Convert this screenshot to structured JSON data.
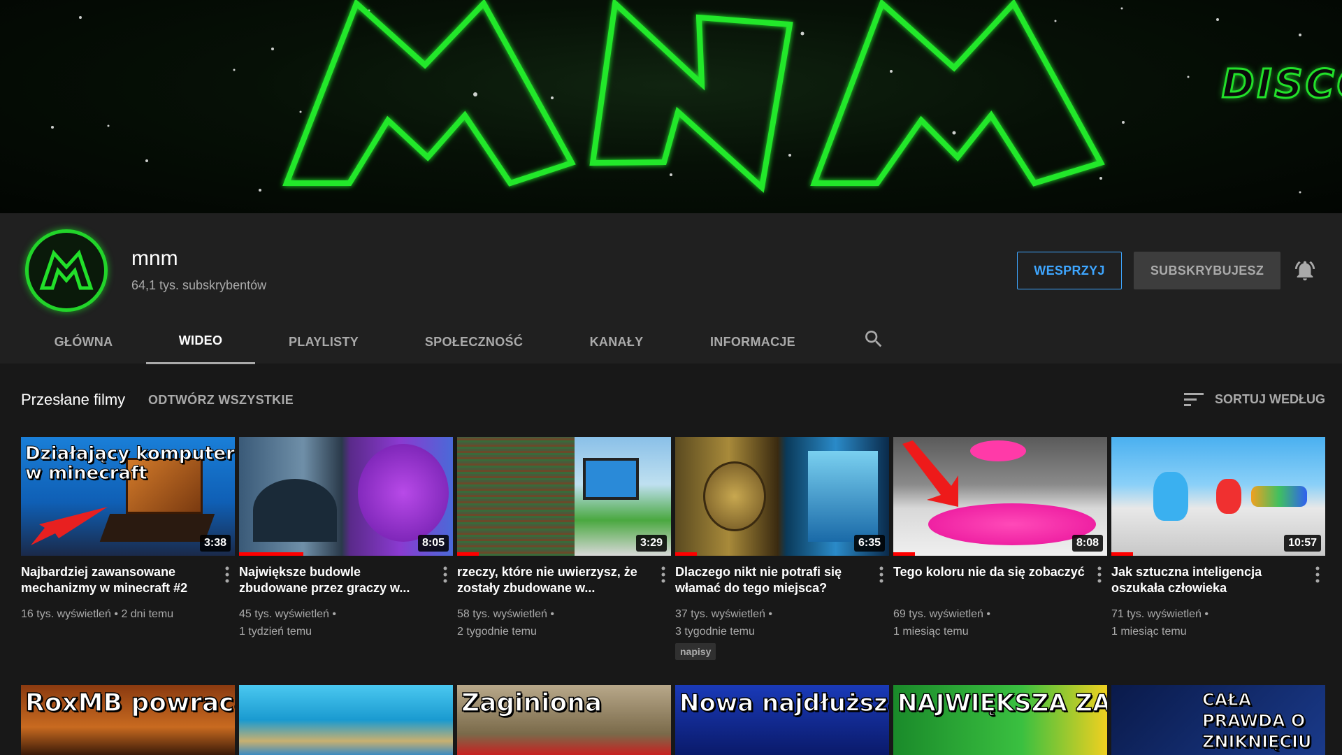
{
  "banner": {
    "logo_text": "MNM",
    "side_text": "DISCO"
  },
  "channel": {
    "name": "mnm",
    "subscribers": "64,1 tys. subskrybentów",
    "support_label": "WESPRZYJ",
    "subscribed_label": "SUBSKRYBUJESZ"
  },
  "tabs": [
    {
      "label": "GŁÓWNA"
    },
    {
      "label": "WIDEO",
      "active": true
    },
    {
      "label": "PLAYLISTY"
    },
    {
      "label": "SPOŁECZNOŚĆ"
    },
    {
      "label": "KANAŁY"
    },
    {
      "label": "INFORMACJE"
    }
  ],
  "section": {
    "title": "Przesłane filmy",
    "play_all": "ODTWÓRZ WSZYSTKIE",
    "sort_label": "SORTUJ WEDŁUG"
  },
  "videos": [
    {
      "title": "Najbardziej zawansowane mechanizmy w minecraft #2",
      "duration": "3:38",
      "views": "16 tys. wyświetleń",
      "age": "2 dni temu",
      "thumb_text": "Działający komputer w minecraft",
      "watched": 0
    },
    {
      "title": "Największe budowle zbudowane przez graczy w...",
      "duration": "8:05",
      "views": "45 tys. wyświetleń",
      "age": "1 tydzień temu",
      "watched": 0.3
    },
    {
      "title": "rzeczy, które nie uwierzysz, że zostały zbudowane w...",
      "duration": "3:29",
      "views": "58 tys. wyświetleń",
      "age": "2 tygodnie temu",
      "watched": 0.1
    },
    {
      "title": "Dlaczego nikt nie potrafi się włamać do tego miejsca?",
      "duration": "6:35",
      "views": "37 tys. wyświetleń",
      "age": "3 tygodnie temu",
      "badge": "napisy",
      "watched": 0.1
    },
    {
      "title": "Tego koloru nie da się zobaczyć",
      "duration": "8:08",
      "views": "69 tys. wyświetleń",
      "age": "1 miesiąc temu",
      "watched": 0.1
    },
    {
      "title": "Jak sztuczna inteligencja oszukała człowieka",
      "duration": "10:57",
      "views": "71 tys. wyświetleń",
      "age": "1 miesiąc temu",
      "watched": 0.1
    }
  ],
  "row2_thumbs": [
    {
      "text": "RoxMB powraca"
    },
    {
      "text": ""
    },
    {
      "text": "Zaginiona"
    },
    {
      "text": "Nowa najdłuższa Reklama na świecie"
    },
    {
      "text": "NAJWIĘKSZA ZAGADKA"
    },
    {
      "text": "CAŁA PRAWDA O ZNIKNIĘCIU RoxMB"
    }
  ],
  "colors": {
    "accent_blue": "#3ea6ff",
    "neon_green": "#22e02a",
    "progress_red": "#ff0000"
  },
  "icons": {
    "bell": "bell-icon",
    "search": "search-icon",
    "sort": "sort-icon",
    "menu": "more-vert-icon"
  }
}
